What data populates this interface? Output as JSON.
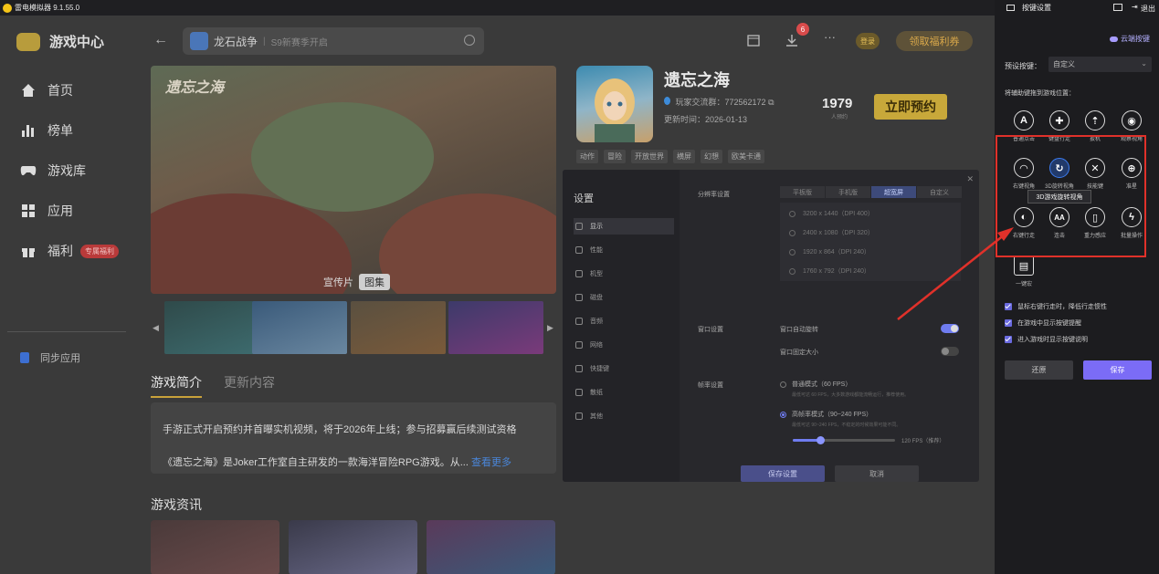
{
  "window": {
    "title": "雷电模拟器 9.1.55.0"
  },
  "sidebar": {
    "brand": "游戏中心",
    "items": [
      {
        "label": "首页",
        "icon": "home-icon"
      },
      {
        "label": "榜单",
        "icon": "chart-icon"
      },
      {
        "label": "游戏库",
        "icon": "gamepad-icon"
      },
      {
        "label": "应用",
        "icon": "apps-icon"
      },
      {
        "label": "福利",
        "icon": "gift-icon",
        "badge": "专属福利"
      }
    ],
    "sync": "同步应用"
  },
  "topbar": {
    "search_game": "龙石战争",
    "search_hint": "S9新赛季开启",
    "download_count": "6",
    "login": "登录",
    "gift": "领取福利券"
  },
  "hero": {
    "logo": "遗忘之海",
    "tab_video": "宣传片",
    "tab_gallery": "图集"
  },
  "game": {
    "name": "遗忘之海",
    "group": "玩家交流群：772562172",
    "update": "更新时间：2026-01-13",
    "count": "1979",
    "count_label": "人预约",
    "reserve": "立即预约",
    "tags": [
      "动作",
      "冒险",
      "开放世界",
      "横屏",
      "幻想",
      "欧美卡通"
    ]
  },
  "content": {
    "tab_intro": "游戏简介",
    "tab_update": "更新内容",
    "desc1": "手游正式开启预约并首曝实机视频，将于2026年上线；参与招募赢后续测试资格",
    "desc2": "《遗忘之海》是Joker工作室自主研发的一款海洋冒险RPG游戏。从...",
    "more": "查看更多",
    "news_title": "游戏资讯"
  },
  "settings": {
    "title": "设置",
    "menu": [
      "显示",
      "性能",
      "机型",
      "磁盘",
      "音频",
      "网络",
      "快捷键",
      "散纸",
      "其他"
    ],
    "res_label": "分辨率设置",
    "segments": [
      "平板版",
      "手机版",
      "超宽屏",
      "自定义"
    ],
    "resolutions": [
      "3200 x 1440（DPI 400）",
      "2400 x 1080（DPI 320）",
      "1920 x 864（DPI 240）",
      "1760 x 792（DPI 240）"
    ],
    "window_label": "窗口设置",
    "auto_rotate": "窗口自动旋转",
    "fixed_size": "窗口固定大小",
    "fps_label": "帧率设置",
    "fps_normal": "普通模式（60 FPS）",
    "fps_normal_sub": "最低可达 60 FPS，大多数游戏都能流畅运行，推荐使用。",
    "fps_high": "高帧率模式（90~240 FPS）",
    "fps_high_sub": "最低可达 90~240 FPS，不稳定的时候效果可能不同。",
    "fps_value": "120 FPS（推荐）",
    "save": "保存设置",
    "cancel": "取消"
  },
  "keypanel": {
    "title": "按键设置",
    "exit": "退出",
    "cloud": "云端按键",
    "preset_label": "预设按键：",
    "preset_value": "自定义",
    "drag_label": "将辅助键拖到游戏位置：",
    "keys": [
      {
        "label": "普通点击",
        "glyph": "A",
        "icon": "tap-icon"
      },
      {
        "label": "键盘行走",
        "glyph": "✚",
        "icon": "dpad-icon"
      },
      {
        "label": "扳机",
        "glyph": "⇡",
        "icon": "trigger-icon"
      },
      {
        "label": "观察视角",
        "glyph": "◉",
        "icon": "eye-icon"
      },
      {
        "label": "右键视角",
        "glyph": "◠",
        "icon": "right-view-icon"
      },
      {
        "label": "3D旋转视角",
        "glyph": "↻",
        "icon": "rotate-icon"
      },
      {
        "label": "技能键",
        "glyph": "✕",
        "icon": "skill-icon"
      },
      {
        "label": "准星",
        "glyph": "⊕",
        "icon": "crosshair-icon"
      },
      {
        "label": "右键行走",
        "glyph": "◐",
        "icon": "mouse-icon"
      },
      {
        "label": "连击",
        "glyph": "AA",
        "icon": "combo-icon"
      },
      {
        "label": "重力感应",
        "glyph": "▯",
        "icon": "gravity-icon"
      },
      {
        "label": "批量操作",
        "glyph": "ϟ",
        "icon": "batch-icon"
      },
      {
        "label": "一键宏",
        "glyph": "▤",
        "icon": "macro-icon"
      }
    ],
    "tooltip": "3D游戏旋转视角",
    "options": [
      "鼠标右键行走时，降低行走惯性",
      "在游戏中显示按键提醒",
      "进入游戏时显示按键说明"
    ],
    "restore": "还原",
    "save": "保存"
  }
}
